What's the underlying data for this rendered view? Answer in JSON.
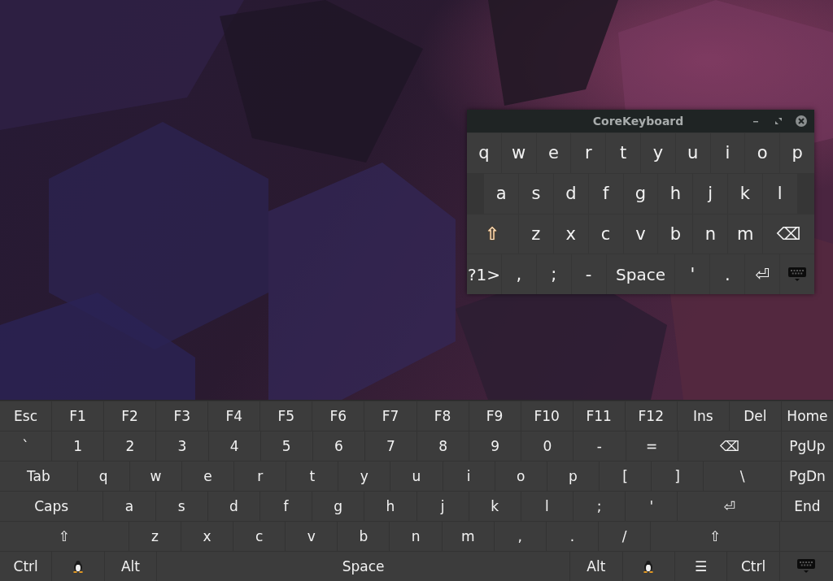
{
  "window": {
    "title": "CoreKeyboard",
    "key_rows": [
      [
        {
          "label": "q"
        },
        {
          "label": "w"
        },
        {
          "label": "e"
        },
        {
          "label": "r"
        },
        {
          "label": "t"
        },
        {
          "label": "y"
        },
        {
          "label": "u"
        },
        {
          "label": "i"
        },
        {
          "label": "o"
        },
        {
          "label": "p"
        }
      ],
      [
        {
          "label": "a"
        },
        {
          "label": "s"
        },
        {
          "label": "d"
        },
        {
          "label": "f"
        },
        {
          "label": "g"
        },
        {
          "label": "h"
        },
        {
          "label": "j"
        },
        {
          "label": "k"
        },
        {
          "label": "l"
        }
      ],
      [
        {
          "label": "⇧",
          "kind": "shift"
        },
        {
          "label": "z"
        },
        {
          "label": "x"
        },
        {
          "label": "c"
        },
        {
          "label": "v"
        },
        {
          "label": "b"
        },
        {
          "label": "n"
        },
        {
          "label": "m"
        },
        {
          "label": "⌫"
        }
      ],
      [
        {
          "label": "?1>"
        },
        {
          "label": ","
        },
        {
          "label": ";"
        },
        {
          "label": "-"
        },
        {
          "label": "Space"
        },
        {
          "label": "'"
        },
        {
          "label": "."
        },
        {
          "label": "⏎"
        },
        {
          "kind": "keyboard"
        }
      ]
    ]
  },
  "keyboard": {
    "key_rows": [
      [
        {
          "label": "Esc"
        },
        {
          "label": "F1"
        },
        {
          "label": "F2"
        },
        {
          "label": "F3"
        },
        {
          "label": "F4"
        },
        {
          "label": "F5"
        },
        {
          "label": "F6"
        },
        {
          "label": "F7"
        },
        {
          "label": "F8"
        },
        {
          "label": "F9"
        },
        {
          "label": "F10"
        },
        {
          "label": "F11"
        },
        {
          "label": "F12"
        },
        {
          "label": "Ins"
        },
        {
          "label": "Del"
        },
        {
          "label": "Home"
        }
      ],
      [
        {
          "label": "`"
        },
        {
          "label": "1"
        },
        {
          "label": "2"
        },
        {
          "label": "3"
        },
        {
          "label": "4"
        },
        {
          "label": "5"
        },
        {
          "label": "6"
        },
        {
          "label": "7"
        },
        {
          "label": "8"
        },
        {
          "label": "9"
        },
        {
          "label": "0"
        },
        {
          "label": "-"
        },
        {
          "label": "="
        },
        {
          "label": "⌫"
        },
        {
          "label": "PgUp"
        }
      ],
      [
        {
          "label": "Tab"
        },
        {
          "label": "q"
        },
        {
          "label": "w"
        },
        {
          "label": "e"
        },
        {
          "label": "r"
        },
        {
          "label": "t"
        },
        {
          "label": "y"
        },
        {
          "label": "u"
        },
        {
          "label": "i"
        },
        {
          "label": "o"
        },
        {
          "label": "p"
        },
        {
          "label": "["
        },
        {
          "label": "]"
        },
        {
          "label": "\\"
        },
        {
          "label": "PgDn"
        }
      ],
      [
        {
          "label": "Caps"
        },
        {
          "label": "a"
        },
        {
          "label": "s"
        },
        {
          "label": "d"
        },
        {
          "label": "f"
        },
        {
          "label": "g"
        },
        {
          "label": "h"
        },
        {
          "label": "j"
        },
        {
          "label": "k"
        },
        {
          "label": "l"
        },
        {
          "label": ";"
        },
        {
          "label": "'"
        },
        {
          "label": "⏎"
        },
        {
          "label": "End"
        }
      ],
      [
        {
          "label": "⇧"
        },
        {
          "label": "z"
        },
        {
          "label": "x"
        },
        {
          "label": "c"
        },
        {
          "label": "v"
        },
        {
          "label": "b"
        },
        {
          "label": "n"
        },
        {
          "label": "m"
        },
        {
          "label": ","
        },
        {
          "label": "."
        },
        {
          "label": "/"
        },
        {
          "label": "⇧"
        },
        {
          "kind": "blank"
        }
      ],
      [
        {
          "label": "Ctrl"
        },
        {
          "kind": "penguin"
        },
        {
          "label": "Alt"
        },
        {
          "label": "Space"
        },
        {
          "label": "Alt"
        },
        {
          "kind": "penguin"
        },
        {
          "label": "☰"
        },
        {
          "label": "Ctrl"
        },
        {
          "kind": "keyboard"
        }
      ]
    ]
  }
}
